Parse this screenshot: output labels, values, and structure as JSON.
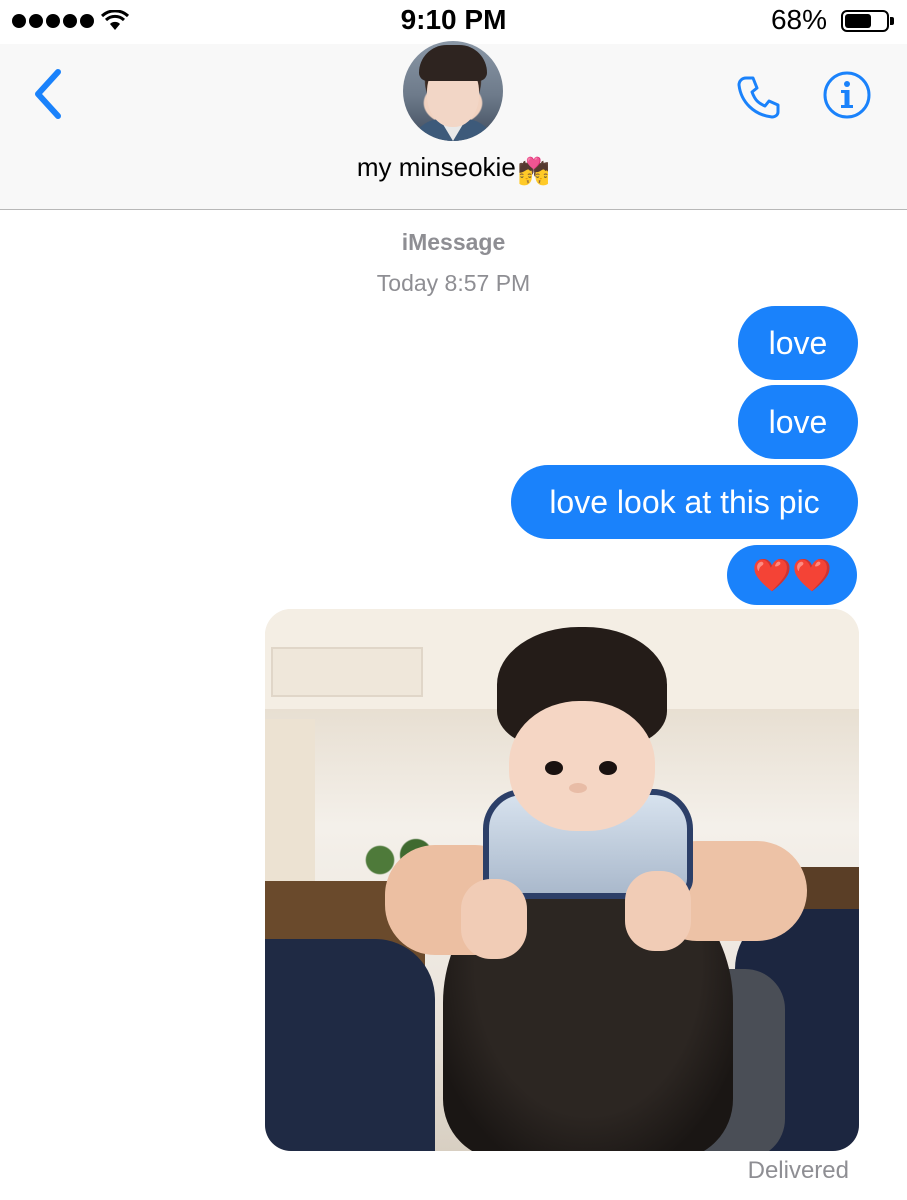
{
  "status_bar": {
    "time": "9:10 PM",
    "battery_percent": "68%",
    "battery_level": 0.68,
    "signal_bars": 5,
    "wifi": "wifi-icon"
  },
  "header": {
    "back_icon": "chevron-left-icon",
    "contact_name": "my minseokie",
    "contact_emoji": "💏",
    "phone_icon": "phone-icon",
    "info_icon": "info-icon"
  },
  "thread": {
    "service": "iMessage",
    "timestamp": "Today 8:57 PM",
    "messages": [
      {
        "text": "love"
      },
      {
        "text": "love"
      },
      {
        "text": "love look at this pic"
      },
      {
        "text": "❤️❤️"
      }
    ],
    "status": "Delivered"
  },
  "colors": {
    "bubble_blue": "#1a82fb",
    "accent": "#1a82fb",
    "meta_gray": "#8e8e93"
  }
}
